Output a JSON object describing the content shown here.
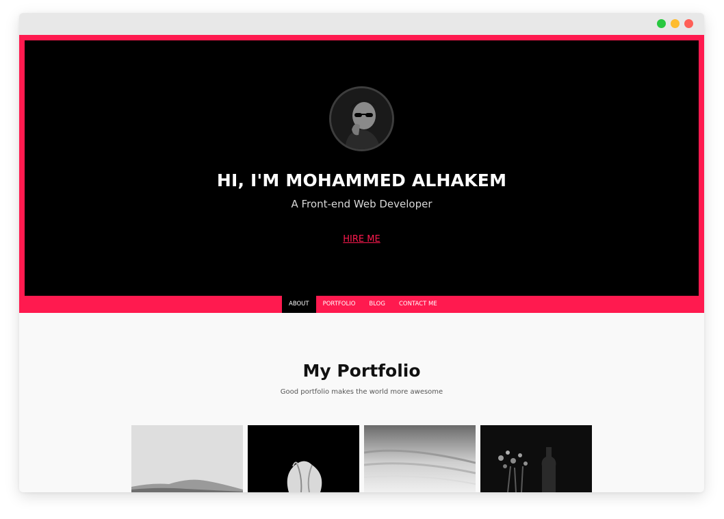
{
  "hero": {
    "title": "HI, I'M MOHAMMED ALHAKEM",
    "subtitle": "A Front-end Web Developer",
    "cta_label": "HIRE ME"
  },
  "nav": {
    "items": [
      {
        "label": "ABOUT",
        "active": true
      },
      {
        "label": "PORTFOLIO",
        "active": false
      },
      {
        "label": "BLOG",
        "active": false
      },
      {
        "label": "CONTACT ME",
        "active": false
      }
    ]
  },
  "portfolio": {
    "title": "My Portfolio",
    "subtitle": "Good portfolio makes the world more awesome",
    "items": [
      {
        "name": "mountain-photo"
      },
      {
        "name": "tulip-photo"
      },
      {
        "name": "sky-photo"
      },
      {
        "name": "flowers-vase-photo"
      }
    ]
  },
  "colors": {
    "accent": "#ff1a4f",
    "hero_bg": "#000000",
    "page_bg": "#f9f9f9"
  },
  "icons": {
    "window_controls": [
      "green-dot",
      "yellow-dot",
      "red-dot"
    ]
  }
}
